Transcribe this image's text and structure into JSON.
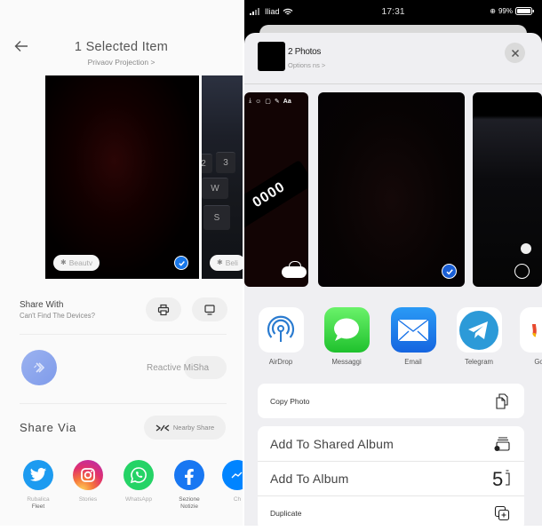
{
  "left_panel": {
    "header": {
      "title": "1 Selected Item",
      "subtitle": "Privaov Projection >"
    },
    "photos": [
      {
        "label": "Beautv",
        "selected": true
      },
      {
        "label": "Beli",
        "selected": false
      }
    ],
    "keyboard_keys": [
      "2",
      "3",
      "W",
      "S"
    ],
    "share_with": {
      "title": "Share With",
      "subtitle": "Can't Find The Devices?",
      "buttons": [
        {
          "icon": "printer-icon"
        },
        {
          "icon": "monitor-icon"
        }
      ]
    },
    "mishare": {
      "icon": "mishare-icon",
      "action_label": "Reactive MiSha"
    },
    "share_via": {
      "title": "Share Via",
      "nearby_label": "Nearby Share",
      "apps": [
        {
          "name": "twitter",
          "label": "Rubalica",
          "label2": "Fleet",
          "color": "#1d9bf0"
        },
        {
          "name": "instagram",
          "label": "Stories",
          "label2": "",
          "color": "#e1306c"
        },
        {
          "name": "whatsapp",
          "label": "WhatsApp",
          "label2": "",
          "color": "#25d366"
        },
        {
          "name": "facebook",
          "label": "Sezione",
          "label2": "Notizie",
          "color": "#1877f2"
        },
        {
          "name": "messenger",
          "label": "Ch",
          "label2": "",
          "color": "#0084ff"
        }
      ]
    }
  },
  "right_panel": {
    "status_bar": {
      "carrier": "Iliad",
      "time": "17:31",
      "battery": "99%"
    },
    "sheet_header": {
      "title": "2 Photos",
      "options": "Options ns >"
    },
    "photos": [
      {
        "sticker_text": "0000",
        "edit_tools": [
          "download",
          "emoji",
          "sticker",
          "draw",
          "Aa"
        ],
        "selected": false
      },
      {
        "selected": true
      },
      {
        "selected": false
      }
    ],
    "apps": [
      {
        "name": "airdrop",
        "label": "AirDrop"
      },
      {
        "name": "messages",
        "label": "Messaggi"
      },
      {
        "name": "email",
        "label": "Email"
      },
      {
        "name": "telegram",
        "label": "Telegram"
      },
      {
        "name": "google",
        "label": "Goo-"
      }
    ],
    "actions_group1": [
      {
        "label": "Copy Photo",
        "icon": "copy-icon"
      }
    ],
    "actions_group2": [
      {
        "label": "Add To Shared Album",
        "icon": "shared-album-icon"
      },
      {
        "label": "Add To Album",
        "icon": "album-icon"
      },
      {
        "label": "Duplicate",
        "icon": "duplicate-icon"
      }
    ]
  },
  "colors": {
    "ios_blue": "#1a5fd6",
    "miui_blue": "#1877e9",
    "sheet_bg": "#efeff2"
  }
}
